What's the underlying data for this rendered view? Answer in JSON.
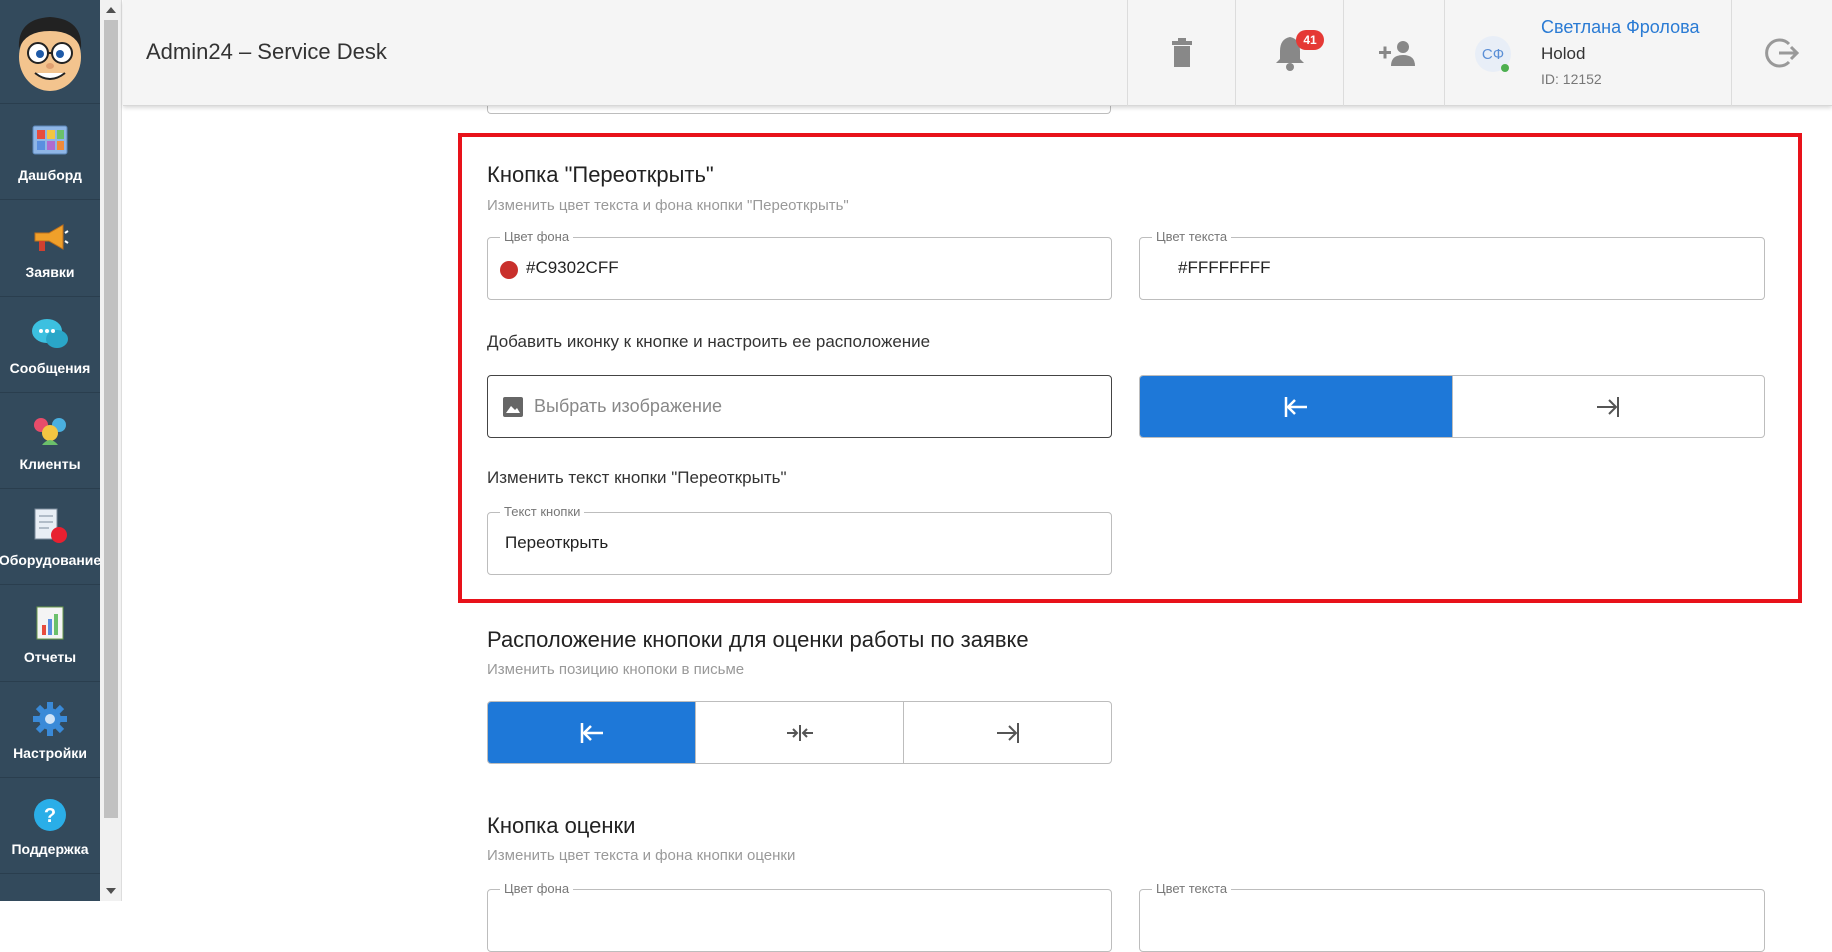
{
  "app": {
    "title": "Admin24 – Service Desk"
  },
  "sidebar": {
    "items": [
      {
        "label": "Дашборд",
        "icon": "dashboard-icon"
      },
      {
        "label": "Заявки",
        "icon": "megaphone-icon"
      },
      {
        "label": "Сообщения",
        "icon": "chat-icon"
      },
      {
        "label": "Клиенты",
        "icon": "clients-icon"
      },
      {
        "label": "Оборудование",
        "icon": "equipment-icon"
      },
      {
        "label": "Отчеты",
        "icon": "reports-icon"
      },
      {
        "label": "Настройки",
        "icon": "gear-icon"
      },
      {
        "label": "Поддержка",
        "icon": "help-icon"
      }
    ]
  },
  "header": {
    "notifications_count": "41",
    "user": {
      "initials": "СФ",
      "name": "Светлана Фролова",
      "company": "Holod",
      "id": "ID: 12152"
    }
  },
  "reopen_button": {
    "title": "Кнопка \"Переоткрыть\"",
    "subtitle": "Изменить цвет текста и фона кнопки \"Переоткрыть\"",
    "bg_color": {
      "legend": "Цвет фона",
      "value": "#C9302CFF",
      "swatch": "#c9302c"
    },
    "text_color": {
      "legend": "Цвет текста",
      "value": "#FFFFFFFF"
    },
    "icon_label": "Добавить иконку к кнопке и настроить ее расположение",
    "image_placeholder": "Выбрать изображение",
    "icon_position": {
      "selected": "left",
      "options": [
        "left",
        "right"
      ]
    },
    "text_label": "Изменить текст кнопки \"Переоткрыть\"",
    "text_field": {
      "legend": "Текст кнопки",
      "value": "Переоткрыть"
    }
  },
  "rating_position": {
    "title": "Расположение кнопоки для оценки работы по заявке",
    "subtitle": "Изменить позицию кнопоки в письме",
    "selected": "left",
    "options": [
      "left",
      "center",
      "right"
    ]
  },
  "rating_button": {
    "title": "Кнопка оценки",
    "subtitle": "Изменить цвет текста и фона кнопки оценки",
    "bg_legend": "Цвет фона",
    "text_legend": "Цвет текста"
  },
  "colors": {
    "accent": "#1e78d8",
    "highlight": "#e8121a",
    "sidebar": "#334a5c"
  }
}
